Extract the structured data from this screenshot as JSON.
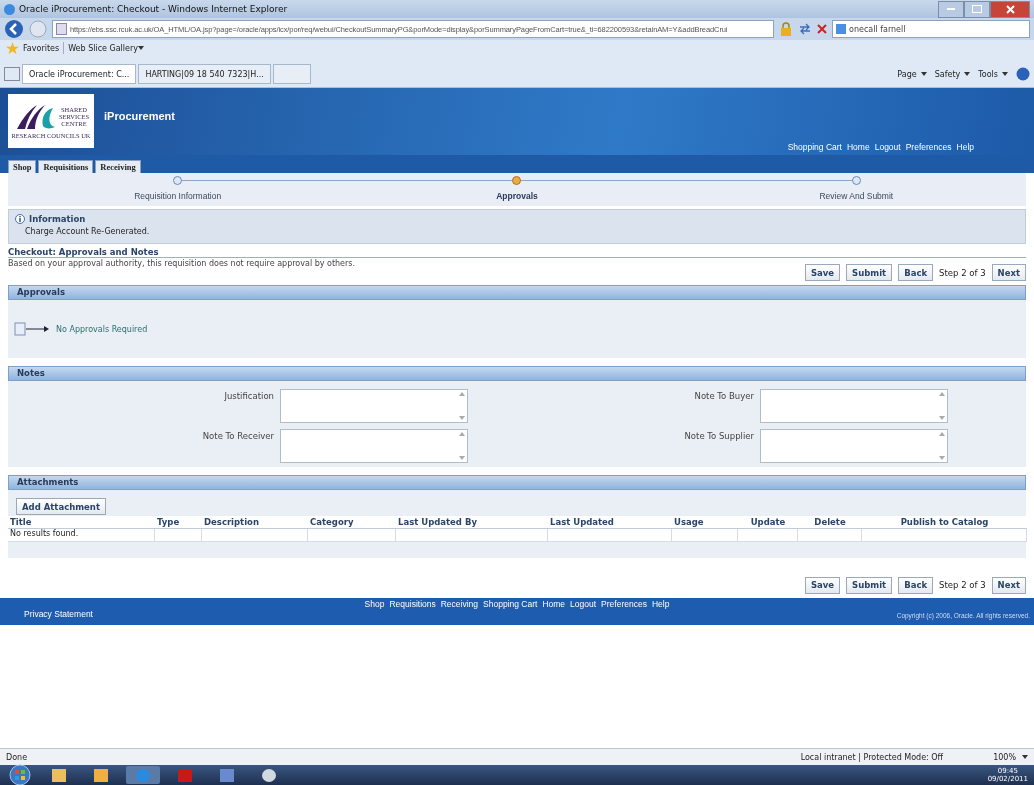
{
  "browser": {
    "title": "Oracle iProcurement: Checkout - Windows Internet Explorer",
    "url": "https://ebs.ssc.rcuk.ac.uk/OA_HTML/OA.jsp?page=/oracle/apps/icx/por/req/webui/CheckoutSummaryPG&porMode=display&porSummaryPageFromCart=true&_ti=682200593&retainAM=Y&addBreadCrui",
    "search": "onecall farnell",
    "favorites": "Favorites",
    "web_slice": "Web Slice Gallery",
    "tabs": [
      {
        "label": "Oracle iProcurement: C...",
        "selected": true
      },
      {
        "label": "HARTING|09 18 540 7323|H...",
        "selected": false
      }
    ],
    "commands": [
      "Page",
      "Safety",
      "Tools"
    ]
  },
  "app": {
    "logo_lines": [
      "SHARED",
      "SERVICES",
      "CENTRE"
    ],
    "logo_caption": "RESEARCH COUNCILS UK",
    "name": "iProcurement",
    "global_links": [
      "Shopping Cart",
      "Home",
      "Logout",
      "Preferences",
      "Help"
    ],
    "tabs": [
      {
        "label": "Shop",
        "selected": false
      },
      {
        "label": "Requisitions",
        "selected": false
      },
      {
        "label": "Receiving",
        "selected": false
      }
    ]
  },
  "train": [
    {
      "label": "Requisition Information",
      "selected": false
    },
    {
      "label": "Approvals",
      "selected": true
    },
    {
      "label": "Review And Submit",
      "selected": false
    }
  ],
  "info": {
    "title": "Information",
    "message": "Charge Account Re-Generated."
  },
  "page_title": "Checkout: Approvals and Notes",
  "description": "Based on your approval authority, this requisition does not require approval by others.",
  "top_actions": {
    "buttons": [
      "Save",
      "Submit",
      "Back"
    ],
    "step": "Step 2 of 3",
    "next": "Next"
  },
  "approvals": {
    "header": "Approvals",
    "message": "No Approvals Required"
  },
  "notes": {
    "header": "Notes",
    "fields": [
      {
        "label": "Justification"
      },
      {
        "label": "Note To Buyer"
      },
      {
        "label": "Note To Receiver"
      },
      {
        "label": "Note To Supplier"
      }
    ]
  },
  "attachments": {
    "header": "Attachments",
    "button": "Add Attachment",
    "columns": [
      "Title",
      "Type",
      "Description",
      "Category",
      "Last Updated By",
      "Last Updated",
      "Usage",
      "Update",
      "Delete",
      "Publish to Catalog"
    ],
    "empty": "No results found."
  },
  "bottom_actions": {
    "buttons": [
      "Save",
      "Submit",
      "Back"
    ],
    "step": "Step 2 of 3",
    "next": "Next"
  },
  "footer": {
    "links": [
      "Shop",
      "Requisitions",
      "Receiving",
      "Shopping Cart",
      "Home",
      "Logout",
      "Preferences",
      "Help"
    ],
    "privacy": "Privacy Statement",
    "copyright": "Copyright (c) 2006, Oracle. All rights reserved."
  },
  "status_bar": {
    "text": "Done",
    "zone": "Local intranet | Protected Mode: Off",
    "zoom": "100%"
  },
  "taskbar": {
    "time": "09:45",
    "date": "09/02/2011"
  }
}
